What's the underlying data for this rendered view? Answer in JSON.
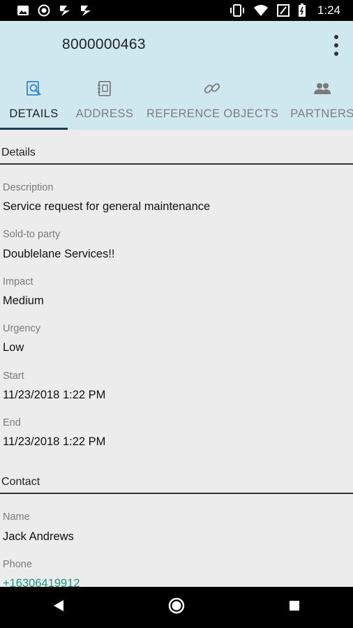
{
  "status_bar": {
    "time": "1:24",
    "left_icons": [
      "image-icon",
      "location-icon",
      "flash-icon",
      "flash-icon"
    ],
    "right_icons": [
      "vibrate-icon",
      "wifi-icon",
      "battery-icon"
    ]
  },
  "header": {
    "title": "8000000463",
    "background": "#cfe8ef"
  },
  "tabs": [
    {
      "label": "DETAILS",
      "icon": "search-document-icon",
      "active": true
    },
    {
      "label": "ADDRESS",
      "icon": "address-book-icon",
      "active": false
    },
    {
      "label": "REFERENCE OBJECTS",
      "icon": "link-icon",
      "active": false
    },
    {
      "label": "PARTNERS",
      "icon": "people-icon",
      "active": false
    }
  ],
  "sections": {
    "details": {
      "title": "Details",
      "fields": [
        {
          "label": "Description",
          "value": "Service request for general maintenance"
        },
        {
          "label": "Sold-to party",
          "value": "Doublelane Services!!"
        },
        {
          "label": "Impact",
          "value": "Medium"
        },
        {
          "label": "Urgency",
          "value": "Low"
        },
        {
          "label": "Start",
          "value": "11/23/2018 1:22 PM"
        },
        {
          "label": "End",
          "value": "11/23/2018 1:22 PM"
        }
      ]
    },
    "contact": {
      "title": "Contact",
      "fields": [
        {
          "label": "Name",
          "value": "Jack Andrews"
        },
        {
          "label": "Phone",
          "value": "+16306419912"
        }
      ]
    }
  },
  "colors": {
    "accent": "#1d3a55",
    "link": "#1a9a7e",
    "icon_blue": "#2f86c8"
  },
  "nav_bar": {
    "buttons": [
      "back-icon",
      "home-icon",
      "recents-icon"
    ]
  }
}
